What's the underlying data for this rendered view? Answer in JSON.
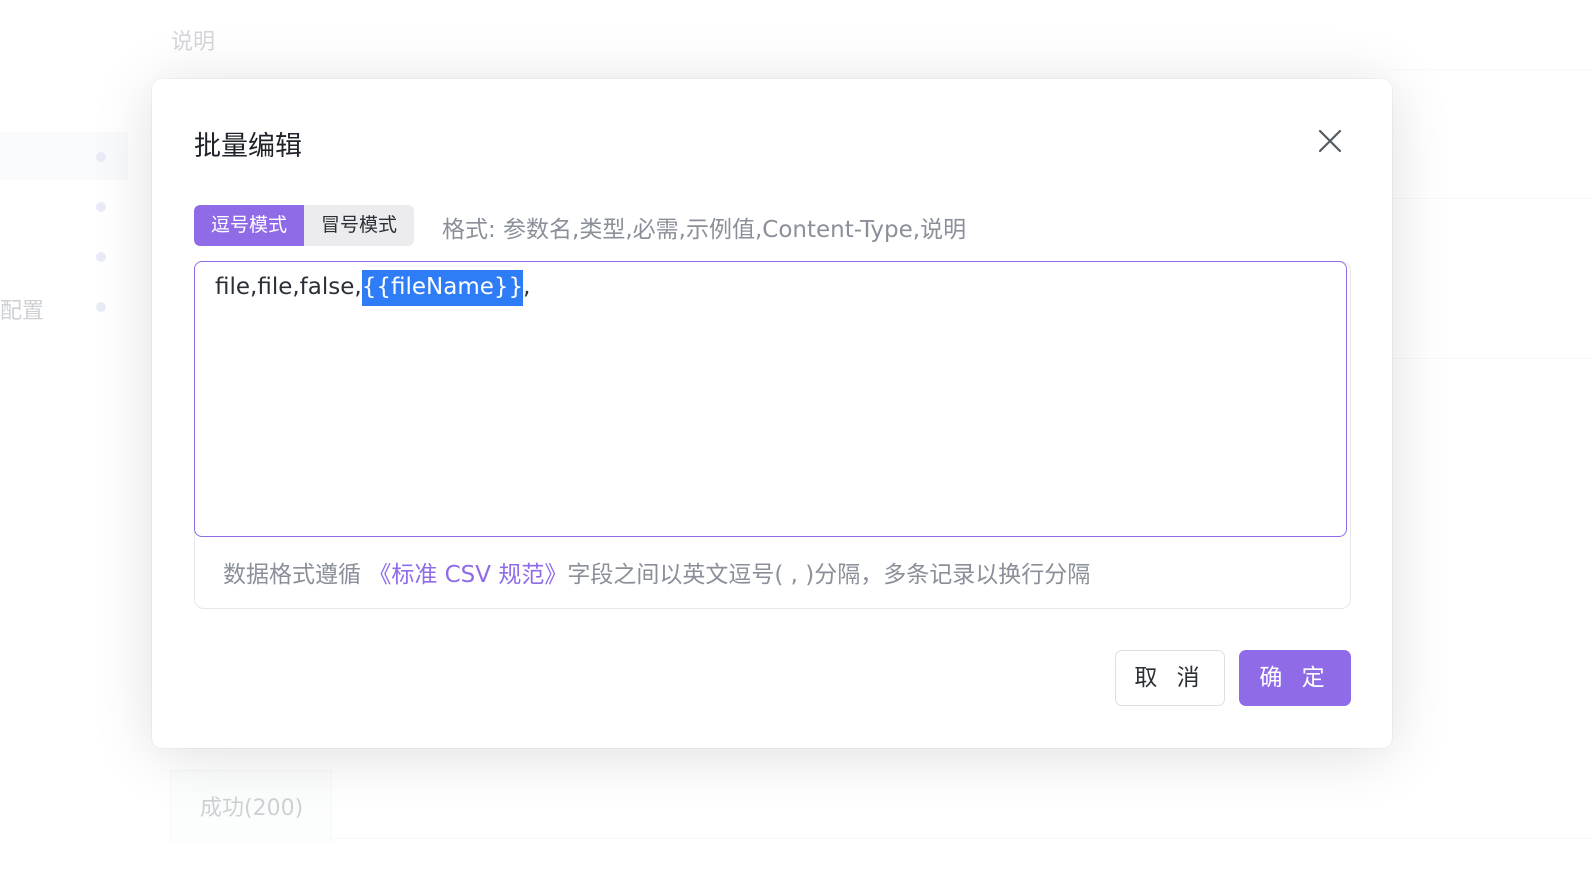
{
  "background": {
    "description_label": "说明",
    "side_config_label": "配置",
    "response_tab_label": "成功(200)"
  },
  "dialog": {
    "title": "批量编辑",
    "close_icon": "close-icon",
    "modes": [
      {
        "label": "逗号模式",
        "active": true
      },
      {
        "label": "冒号模式",
        "active": false
      }
    ],
    "format_hint": "格式: 参数名,类型,必需,示例值,Content-Type,说明",
    "editor": {
      "text_before": "file,file,false,",
      "selected_text": "{{fileName}}",
      "text_after": ","
    },
    "footer": {
      "prefix": "数据格式遵循 ",
      "link": "《标准 CSV 规范》",
      "suffix": "字段之间以英文逗号( , )分隔，多条记录以换行分隔"
    },
    "cancel_label": "取 消",
    "ok_label": "确 定"
  },
  "colors": {
    "accent": "#8f6be8",
    "selection": "#2f7df6"
  }
}
